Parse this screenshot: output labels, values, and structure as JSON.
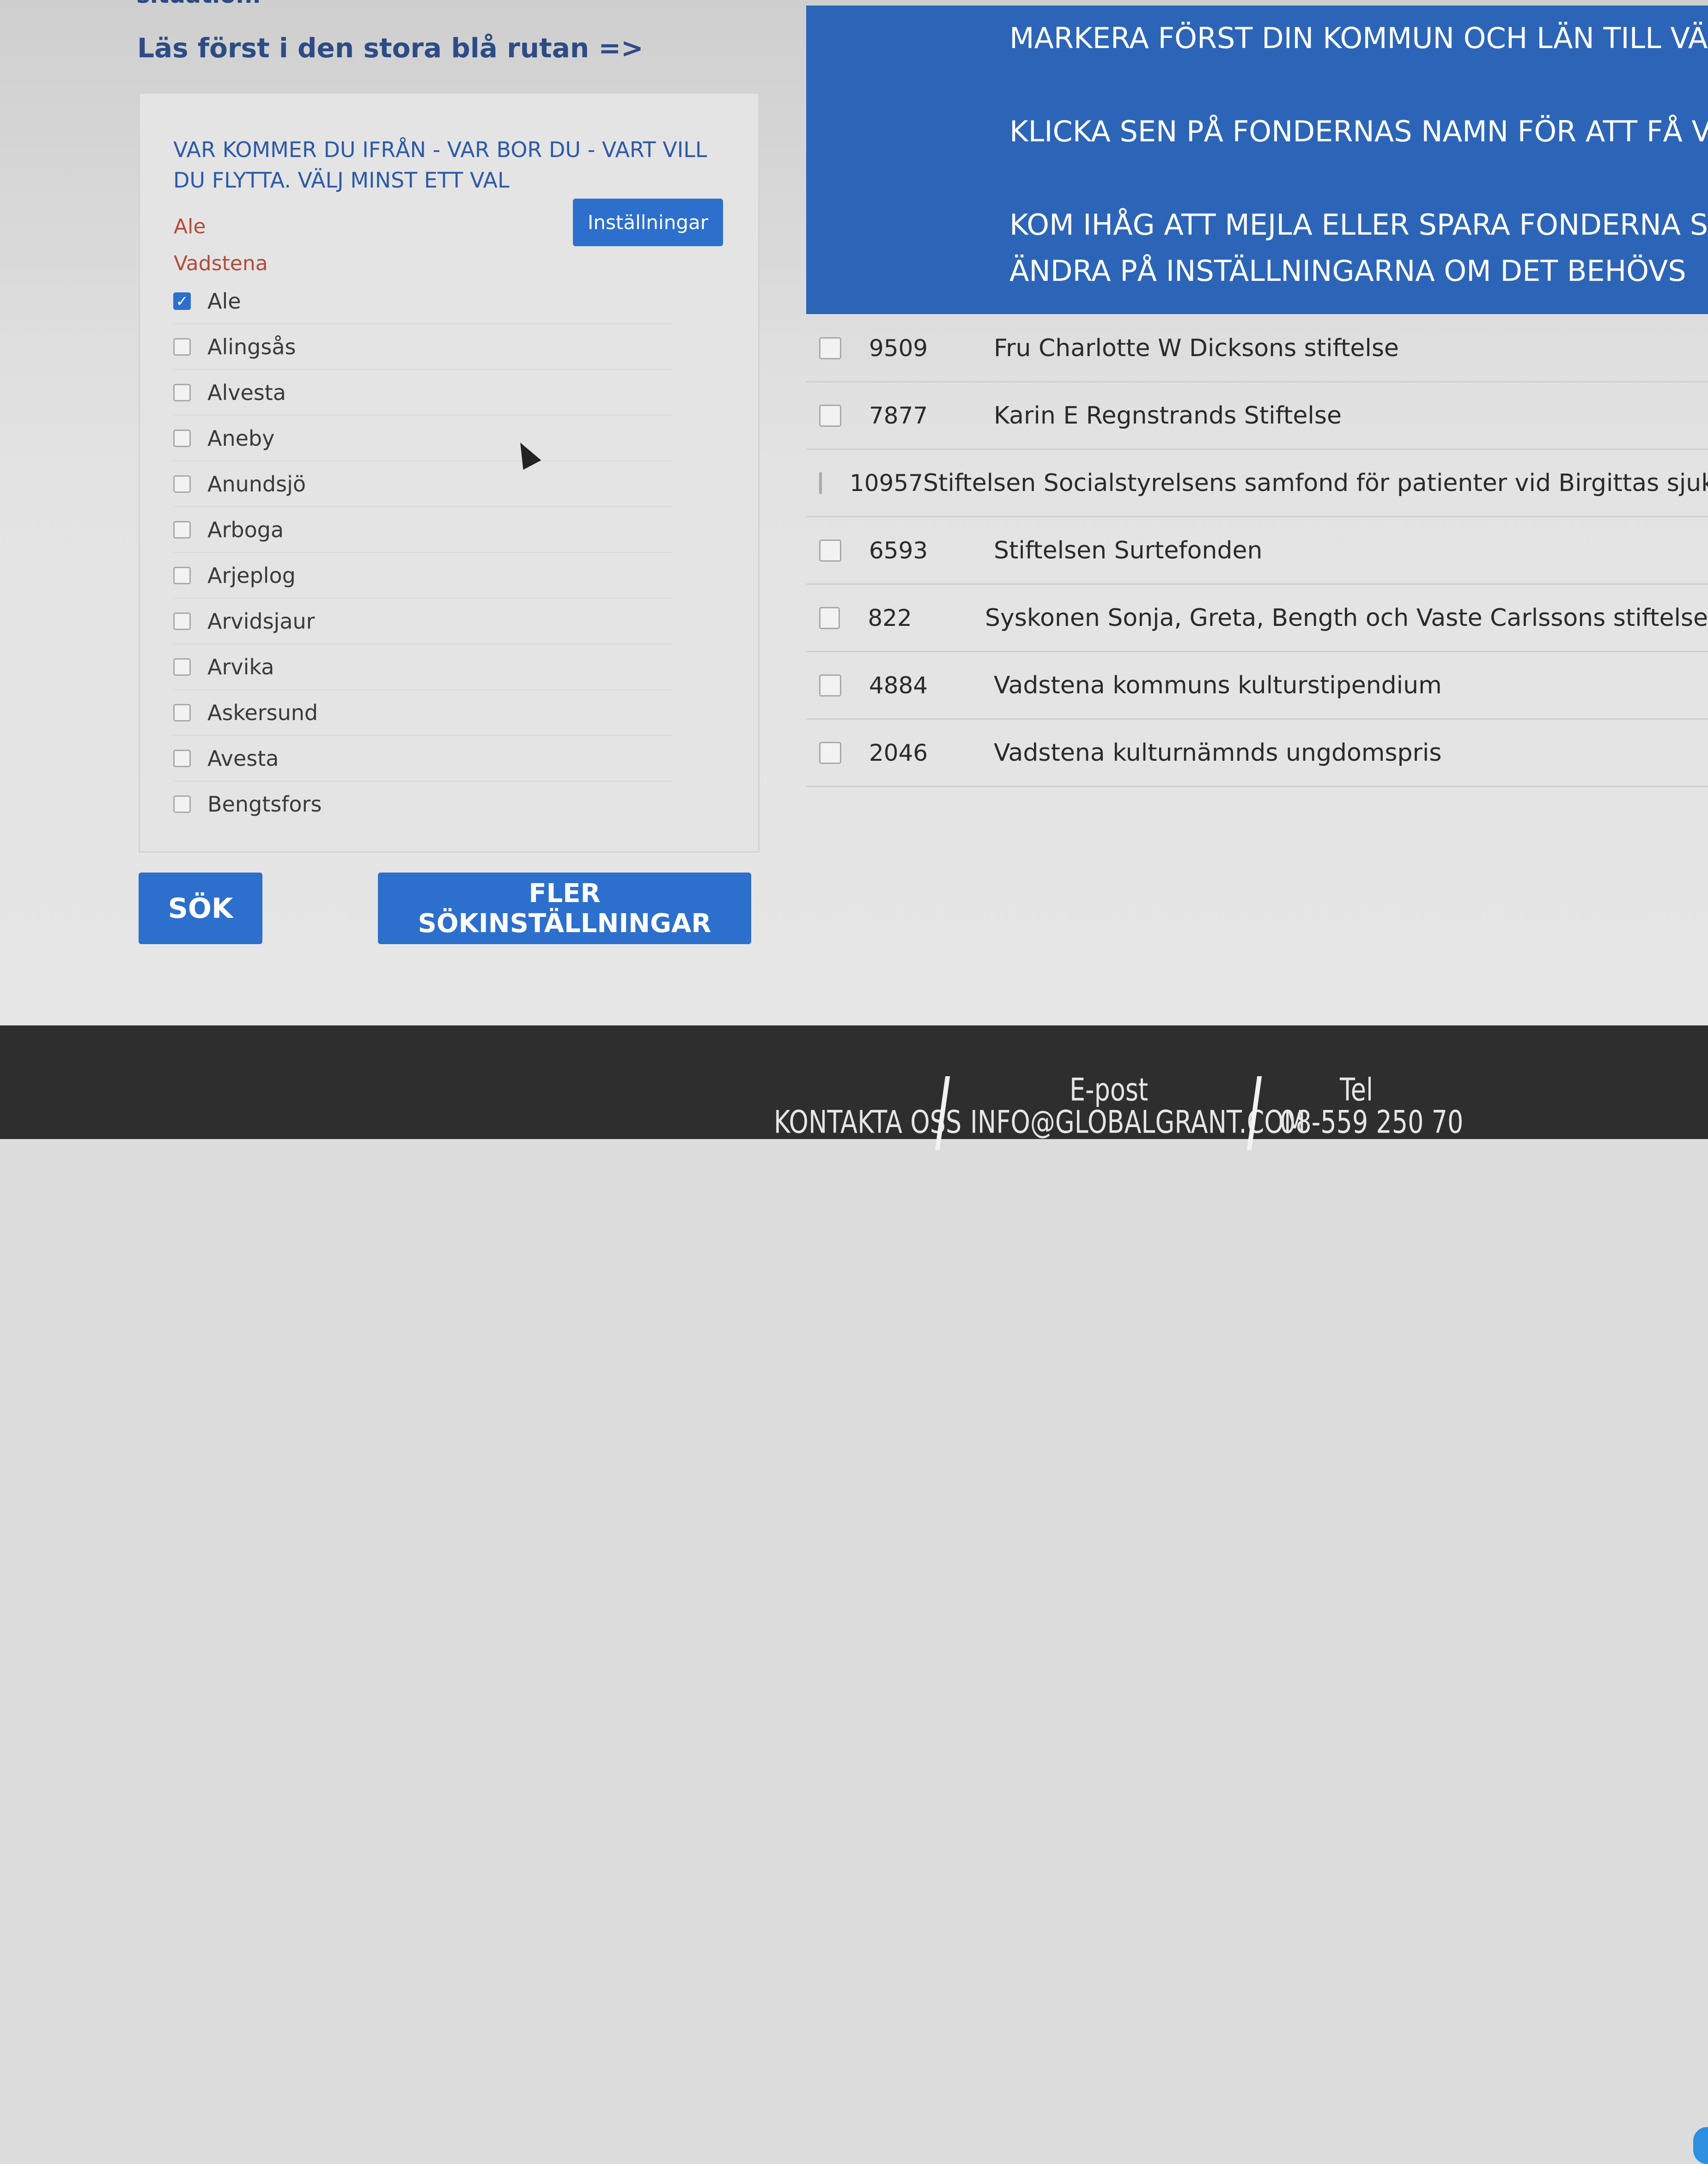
{
  "intro": {
    "cut_heading": "situation.",
    "text": "Läs först i den stora blå rutan =>"
  },
  "panel": {
    "title": "VAR KOMMER DU IFRÅN - VAR BOR DU - VART VILL DU FLYTTA. VÄLJ MINST ETT VAL",
    "settings_button": "Inställningar",
    "selected": [
      "Ale",
      "Vadstena"
    ],
    "items": [
      {
        "label": "Ale",
        "checked": true
      },
      {
        "label": "Alingsås",
        "checked": false
      },
      {
        "label": "Alvesta",
        "checked": false
      },
      {
        "label": "Aneby",
        "checked": false
      },
      {
        "label": "Anundsjö",
        "checked": false
      },
      {
        "label": "Arboga",
        "checked": false
      },
      {
        "label": "Arjeplog",
        "checked": false
      },
      {
        "label": "Arvidsjaur",
        "checked": false
      },
      {
        "label": "Arvika",
        "checked": false
      },
      {
        "label": "Askersund",
        "checked": false
      },
      {
        "label": "Avesta",
        "checked": false
      },
      {
        "label": "Bengtsfors",
        "checked": false
      }
    ]
  },
  "actions": {
    "search": "SÖK",
    "more_settings": "FLER SÖKINSTÄLLNINGAR"
  },
  "banner": {
    "line1": "MARKERA FÖRST DIN KOMMUN OCH LÄN TILL VÄNS",
    "line2": "KLICKA SEN PÅ FONDERNAS NAMN FÖR ATT FÅ VETA",
    "line3": "KOM IHÅG ATT MEJLA ELLER SPARA FONDERNA SOM",
    "line4": "ÄNDRA PÅ INSTÄLLNINGARNA OM DET BEHÖVS"
  },
  "results": [
    {
      "id": "9509",
      "name": "Fru Charlotte W Dicksons stiftelse"
    },
    {
      "id": "7877",
      "name": "Karin E Regnstrands Stiftelse"
    },
    {
      "id": "10957",
      "name": "Stiftelsen Socialstyrelsens samfond för patienter vid Birgittas sjukh"
    },
    {
      "id": "6593",
      "name": "Stiftelsen Surtefonden"
    },
    {
      "id": "822",
      "name": "Syskonen Sonja, Greta, Bength och Vaste Carlssons stiftelse"
    },
    {
      "id": "4884",
      "name": "Vadstena kommuns kulturstipendium"
    },
    {
      "id": "2046",
      "name": "Vadstena kulturnämnds ungdomspris"
    }
  ],
  "footer": {
    "contact": "KONTAKTA OSS",
    "email_label": "E-post",
    "email": "INFO@GLOBALGRANT.COM",
    "phone_label": "Tel",
    "phone": "08-559 250 70"
  },
  "colors": {
    "accent": "#2d6fcc",
    "banner": "#2c65b8",
    "selected_text": "#b24b3a",
    "footer": "#2e2e2e"
  }
}
